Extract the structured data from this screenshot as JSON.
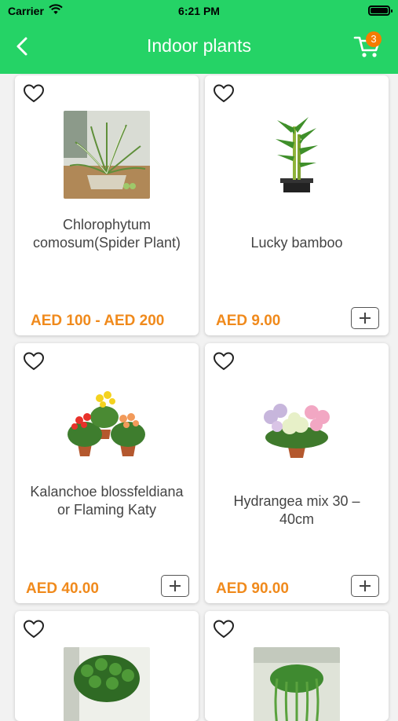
{
  "status_bar": {
    "carrier": "Carrier",
    "time": "6:21 PM"
  },
  "header": {
    "title": "Indoor plants",
    "cart_count": "3"
  },
  "products": [
    {
      "name": "Chlorophytum comosum(Spider Plant)",
      "price": "AED 100 - AED 200",
      "has_add": false
    },
    {
      "name": "Lucky bamboo",
      "price": "AED 9.00",
      "has_add": true
    },
    {
      "name": "Kalanchoe blossfeldiana or Flaming Katy",
      "price": "AED 40.00",
      "has_add": true
    },
    {
      "name": "Hydrangea mix 30 – 40cm",
      "price": "AED 90.00",
      "has_add": true
    }
  ],
  "colors": {
    "accent": "#25d366",
    "price": "#f08a1c",
    "badge": "#f57c00"
  }
}
